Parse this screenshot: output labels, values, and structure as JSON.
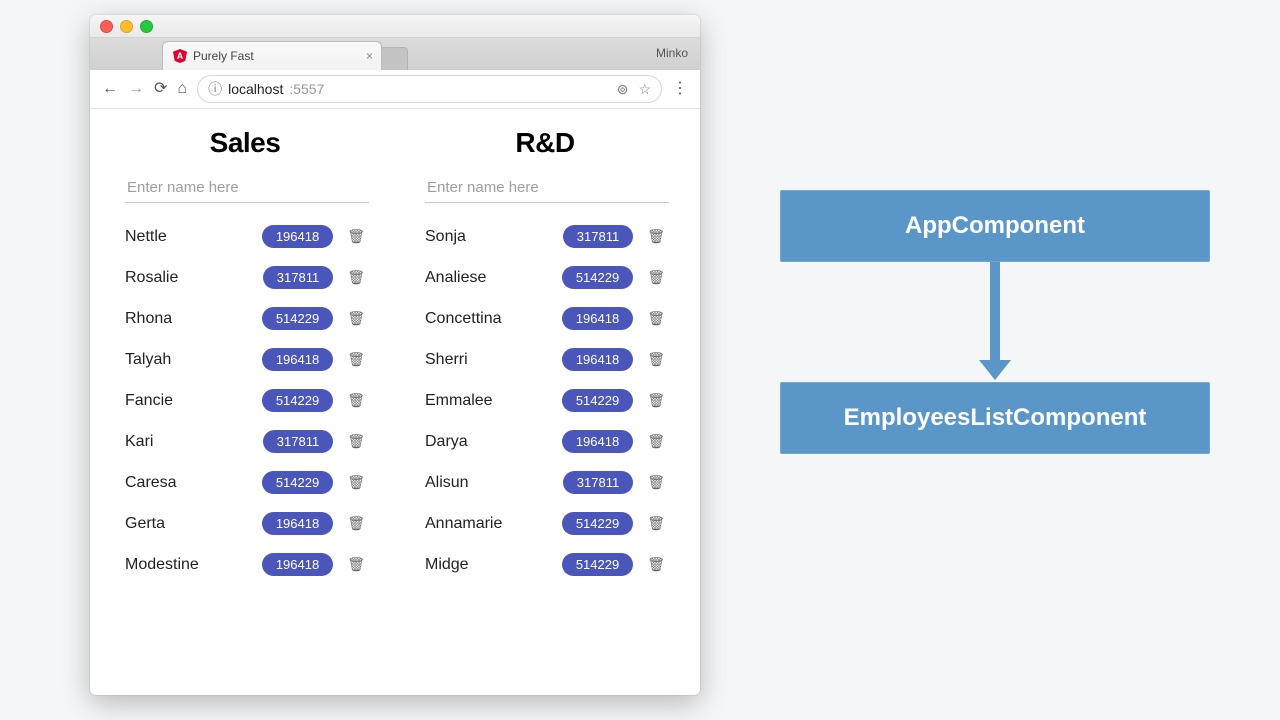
{
  "browser": {
    "tab_title": "Purely Fast",
    "profile_name": "Minko",
    "url_host": "localhost",
    "url_port": ":5557",
    "tab_close": "×",
    "omni_info_glyph": "ⓘ",
    "nav_back": "←",
    "nav_fwd": "→",
    "nav_reload": "⟳",
    "nav_home": "⌂",
    "omni_target": "⊚",
    "omni_star": "☆",
    "omni_menu": "⋮"
  },
  "page": {
    "columns": [
      {
        "title": "Sales",
        "placeholder": "Enter name here",
        "rows": [
          {
            "name": "Nettle",
            "num": "196418"
          },
          {
            "name": "Rosalie",
            "num": "317811"
          },
          {
            "name": "Rhona",
            "num": "514229"
          },
          {
            "name": "Talyah",
            "num": "196418"
          },
          {
            "name": "Fancie",
            "num": "514229"
          },
          {
            "name": "Kari",
            "num": "317811"
          },
          {
            "name": "Caresa",
            "num": "514229"
          },
          {
            "name": "Gerta",
            "num": "196418"
          },
          {
            "name": "Modestine",
            "num": "196418"
          }
        ]
      },
      {
        "title": "R&D",
        "placeholder": "Enter name here",
        "rows": [
          {
            "name": "Sonja",
            "num": "317811"
          },
          {
            "name": "Analiese",
            "num": "514229"
          },
          {
            "name": "Concettina",
            "num": "196418"
          },
          {
            "name": "Sherri",
            "num": "196418"
          },
          {
            "name": "Emmalee",
            "num": "514229"
          },
          {
            "name": "Darya",
            "num": "196418"
          },
          {
            "name": "Alisun",
            "num": "317811"
          },
          {
            "name": "Annamarie",
            "num": "514229"
          },
          {
            "name": "Midge",
            "num": "514229"
          }
        ]
      }
    ],
    "trash_glyph": "🗑"
  },
  "diagram": {
    "top": "AppComponent",
    "bottom": "EmployeesListComponent"
  }
}
